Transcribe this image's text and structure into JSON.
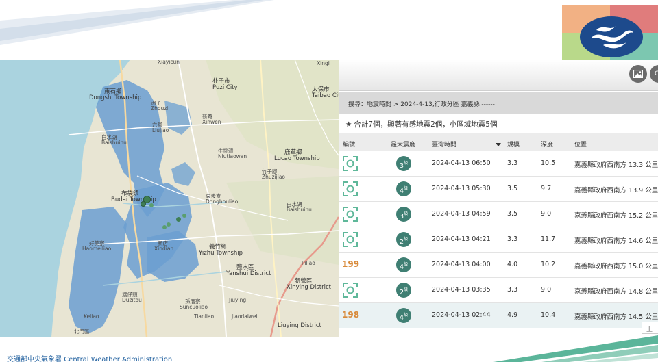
{
  "colors": {
    "accent": "#3f7f73",
    "id_link": "#d88a3a",
    "footer_text": "#1f5f9e",
    "sea": "#aad3df",
    "land": "#e8e5d3",
    "aquaculture": "#6b9fd1"
  },
  "toolbar": {
    "buttons": [
      {
        "icon": "image-icon",
        "label": ""
      },
      {
        "icon": "csv-icon",
        "label": "CS"
      }
    ]
  },
  "query": {
    "text": "搜尋：地震時間 > 2024-4-13,行政分區 嘉義縣 ------"
  },
  "summary": {
    "icon": "star-icon",
    "text": "合計7個，顯著有感地震2個，小區域地震5個"
  },
  "table": {
    "columns": [
      "編號",
      "最大震度",
      "臺灣時間",
      "規模",
      "深度",
      "位置"
    ],
    "sorted_column": "臺灣時間",
    "rows": [
      {
        "id": "",
        "id_icon": "focus-icon",
        "intensity": "3",
        "intensity_unit": "級",
        "time": "2024-04-13 06:50",
        "magnitude": "3.3",
        "depth": "10.5",
        "location": "嘉義縣政府西南方 13.3 公里"
      },
      {
        "id": "",
        "id_icon": "focus-icon",
        "intensity": "4",
        "intensity_unit": "級",
        "time": "2024-04-13 05:30",
        "magnitude": "3.5",
        "depth": "9.7",
        "location": "嘉義縣政府西南方 13.9 公里"
      },
      {
        "id": "",
        "id_icon": "focus-icon",
        "intensity": "3",
        "intensity_unit": "級",
        "time": "2024-04-13 04:59",
        "magnitude": "3.5",
        "depth": "9.0",
        "location": "嘉義縣政府西南方 15.2 公里"
      },
      {
        "id": "",
        "id_icon": "focus-icon",
        "intensity": "2",
        "intensity_unit": "級",
        "time": "2024-04-13 04:21",
        "magnitude": "3.3",
        "depth": "11.7",
        "location": "嘉義縣政府西南方 14.6 公里"
      },
      {
        "id": "199",
        "id_icon": "",
        "intensity": "4",
        "intensity_unit": "級",
        "time": "2024-04-13 04:00",
        "magnitude": "4.0",
        "depth": "10.2",
        "location": "嘉義縣政府西南方 15.0 公里"
      },
      {
        "id": "",
        "id_icon": "focus-icon",
        "intensity": "2",
        "intensity_unit": "級",
        "time": "2024-04-13 03:35",
        "magnitude": "3.3",
        "depth": "9.0",
        "location": "嘉義縣政府西南方 14.8 公里"
      },
      {
        "id": "198",
        "id_icon": "",
        "intensity": "4",
        "intensity_unit": "級",
        "time": "2024-04-13 02:44",
        "magnitude": "4.9",
        "depth": "10.4",
        "location": "嘉義縣政府西南方 14.5 公里"
      }
    ]
  },
  "pager": {
    "prev_label": "上一"
  },
  "map": {
    "labels": [
      {
        "zh": "下寮",
        "en": "Xiayicun"
      },
      {
        "zh": "",
        "en": "Xingi"
      },
      {
        "zh": "朴子市",
        "en": "Puzi City"
      },
      {
        "zh": "太保市",
        "en": "Taibao City"
      },
      {
        "zh": "東石鄉",
        "en": "Dongshi Township"
      },
      {
        "zh": "洲子",
        "en": "Zhouzi"
      },
      {
        "zh": "新菴",
        "en": "Xinwen"
      },
      {
        "zh": "六腳",
        "en": "Liujiao"
      },
      {
        "zh": "白水湖",
        "en": "Baishuihu"
      },
      {
        "zh": "牛挑灣",
        "en": "Niutiaowan"
      },
      {
        "zh": "鹿草鄉",
        "en": "Lucao Township"
      },
      {
        "zh": "竹子腳",
        "en": "Zhuzijiao"
      },
      {
        "zh": "布袋鎮",
        "en": "Budai Township"
      },
      {
        "zh": "東後寮",
        "en": "Donghouliao"
      },
      {
        "zh": "白水湖",
        "en": "Baishuihu"
      },
      {
        "zh": "好美寮",
        "en": "Haomeiliao"
      },
      {
        "zh": "新店",
        "en": "Xindian"
      },
      {
        "zh": "義竹鄉",
        "en": "Yizhu Township"
      },
      {
        "zh": "鹽水區",
        "en": "Yanshui District"
      },
      {
        "zh": "",
        "en": "Piliao"
      },
      {
        "zh": "渡仔頭",
        "en": "Duzitou"
      },
      {
        "zh": "孫厝寮",
        "en": "Suncuoliao"
      },
      {
        "zh": "",
        "en": "Jiuying"
      },
      {
        "zh": "新營區",
        "en": "Xinying District"
      },
      {
        "zh": "",
        "en": "Keliao"
      },
      {
        "zh": "",
        "en": "Tianliao"
      },
      {
        "zh": "",
        "en": "Jiaodaiwei"
      },
      {
        "zh": "",
        "en": "Liuying District"
      },
      {
        "zh": "北門區",
        "en": ""
      }
    ],
    "epicenters": [
      {
        "id": "198",
        "size": "large"
      },
      {
        "id": "199",
        "size": "large"
      },
      {
        "id": "small-1",
        "size": "small"
      },
      {
        "id": "small-2",
        "size": "small"
      },
      {
        "id": "small-3",
        "size": "small"
      },
      {
        "id": "small-4",
        "size": "small"
      },
      {
        "id": "small-5",
        "size": "small"
      }
    ]
  },
  "footer": {
    "agency": "交通部中央氣象署 Central Weather Administration"
  }
}
